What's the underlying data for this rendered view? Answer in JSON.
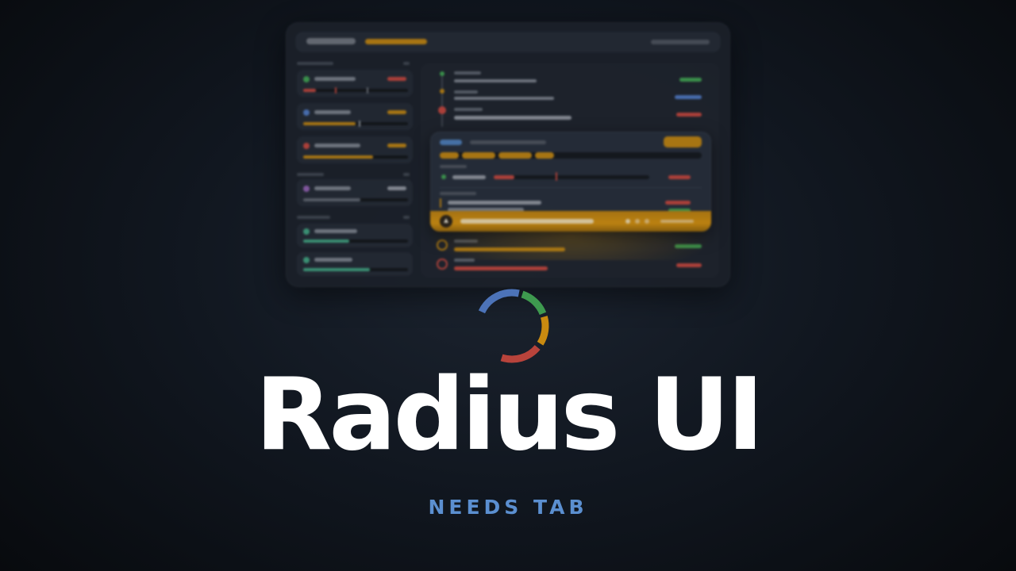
{
  "brand": {
    "title": "Radius UI",
    "subtitle": "NEEDS TAB"
  },
  "colors": {
    "accent_blue": "#5b8fd0",
    "amber": "#c98a10",
    "green": "#3e9a4f",
    "red": "#b8433b",
    "blue": "#4c73b8",
    "title_white": "#ffffff"
  },
  "spinner": {
    "segments": [
      "blue",
      "green",
      "amber",
      "red"
    ]
  }
}
